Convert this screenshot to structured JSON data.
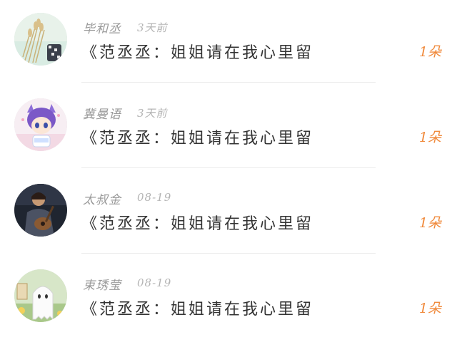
{
  "items": [
    {
      "name": "毕和丞",
      "time": "3天前",
      "title": "《范丞丞：姐姐请在我心里留",
      "count": "1朵",
      "avatar": "avatar-wheat-photo"
    },
    {
      "name": "冀曼语",
      "time": "3天前",
      "title": "《范丞丞：姐姐请在我心里留",
      "count": "1朵",
      "avatar": "avatar-anime-cat-boy"
    },
    {
      "name": "太叔金",
      "time": "08-19",
      "title": "《范丞丞：姐姐请在我心里留",
      "count": "1朵",
      "avatar": "avatar-guitar-portrait"
    },
    {
      "name": "束琇莹",
      "time": "08-19",
      "title": "《范丞丞：姐姐请在我心里留",
      "count": "1朵",
      "avatar": "avatar-ghost-cartoon"
    }
  ],
  "colors": {
    "accent": "#f08a3c",
    "name": "#9a9a9a",
    "title": "#333333",
    "divider": "#ececec"
  }
}
